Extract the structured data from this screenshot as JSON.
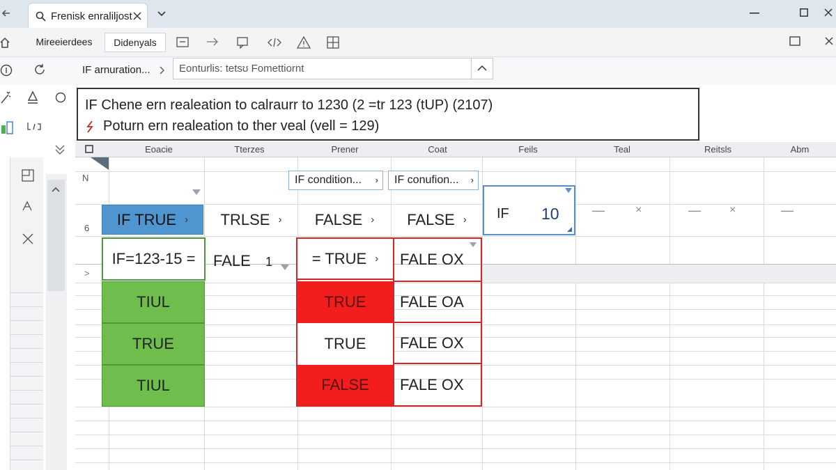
{
  "window": {
    "tab_title": "Frenisk enraliljost",
    "icons": [
      "back-icon",
      "search-icon",
      "close-tab-icon",
      "tab-list-icon",
      "minimize-icon",
      "maximize-icon",
      "window-close-icon"
    ]
  },
  "toolbar": {
    "btn1_label": "Mireeierdees",
    "btn2_label": "Didenyals",
    "icons": [
      "home-icon",
      "rectangle-icon",
      "arrow-right-icon",
      "comment-icon",
      "code-icon",
      "warning-icon",
      "grid-icon",
      "window-icon",
      "close-icon"
    ]
  },
  "formula_bar": {
    "name_box": "IF arnuration...",
    "input_placeholder": "Eonturlis: tetsʊ Fomettiornt"
  },
  "description": {
    "line1": "IF  Chene ern realeation to calraurr to 1230 (2 =tr 123 (tUP)  (2107)",
    "line2": "Poturn ern realeation  to ther veal  (vell  = 129)"
  },
  "columns": [
    "Eoacie",
    "Tterzes",
    "Prener",
    "Coat",
    "Feils",
    "Teal",
    "Reitsls",
    "Abm"
  ],
  "row_labels": {
    "n": "N",
    "six": "6",
    "arrow": ">"
  },
  "dropdowns": {
    "cond1": "IF condition...",
    "cond2": "IF conufion..."
  },
  "row_if": {
    "c1": "IF TRUE",
    "c2": "TRLSE",
    "c3": "FALSE",
    "c4": "FALSE",
    "c5_label": "IF",
    "c5_value": "10",
    "dash": "—",
    "x": "×"
  },
  "row_formula": {
    "c1": "IF=123-15  =",
    "c2": "FALE",
    "c2b": "1",
    "c3": "=  TRUE",
    "c4": "FALE OX"
  },
  "green_cells": [
    "TIUL",
    "TRUE",
    "TIUL"
  ],
  "mid_cells": [
    "TRUE",
    "TRUE",
    "FALSE"
  ],
  "right_cells": [
    "FALE OA",
    "FALE OX",
    "FALE OX"
  ],
  "colors": {
    "green": "#6fbd4c",
    "red": "#f21e1e",
    "blue": "#4f95d0",
    "accent_border": "#d42626"
  }
}
